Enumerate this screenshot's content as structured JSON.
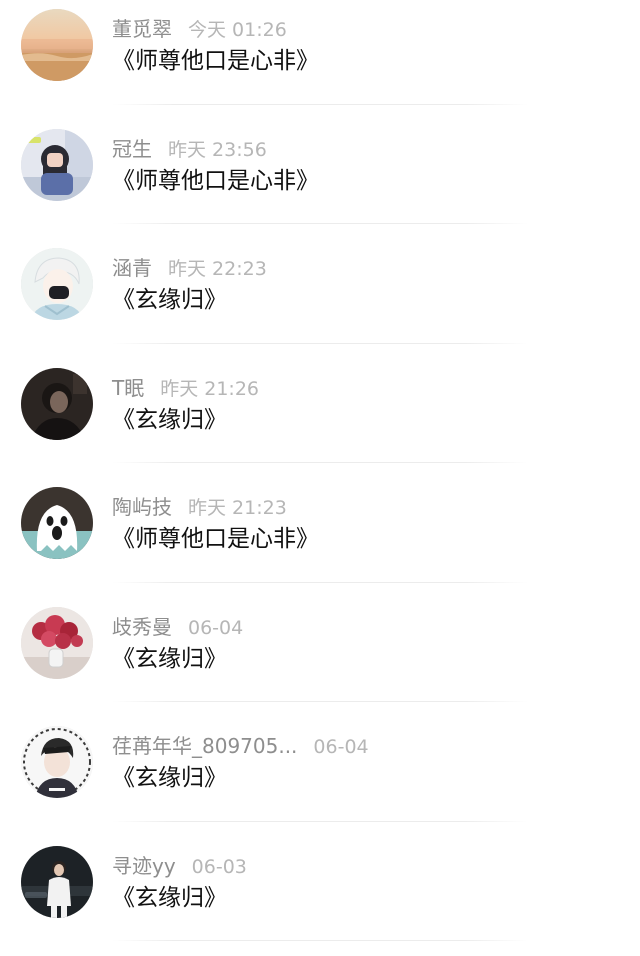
{
  "comments": [
    {
      "name": "董觅翠",
      "time": "今天 01:26",
      "content": "《师尊他口是心非》",
      "avatar": "beach-sunset-avatar"
    },
    {
      "name": "冠生",
      "time": "昨天 23:56",
      "content": "《师尊他口是心非》",
      "avatar": "girl-covering-face-avatar"
    },
    {
      "name": "涵青",
      "time": "昨天 22:23",
      "content": "《玄缘归》",
      "avatar": "anime-boy-mask-avatar"
    },
    {
      "name": "T眠",
      "time": "昨天 21:26",
      "content": "《玄缘归》",
      "avatar": "dark-portrait-avatar"
    },
    {
      "name": "陶屿技",
      "time": "昨天 21:23",
      "content": "《师尊他口是心非》",
      "avatar": "ghost-cartoon-avatar"
    },
    {
      "name": "歧秀曼",
      "time": "06-04",
      "content": "《玄缘归》",
      "avatar": "roses-vase-avatar"
    },
    {
      "name": "荏苒年华_809705...",
      "time": "06-04",
      "content": "《玄缘归》",
      "avatar": "illustrated-boy-avatar"
    },
    {
      "name": "寻迹yy",
      "time": "06-03",
      "content": "《玄缘归》",
      "avatar": "performer-stage-avatar"
    }
  ],
  "colors": {
    "name": "#8e8e8e",
    "time": "#b6b6b6",
    "content": "#111111",
    "divider": "#ececec"
  }
}
